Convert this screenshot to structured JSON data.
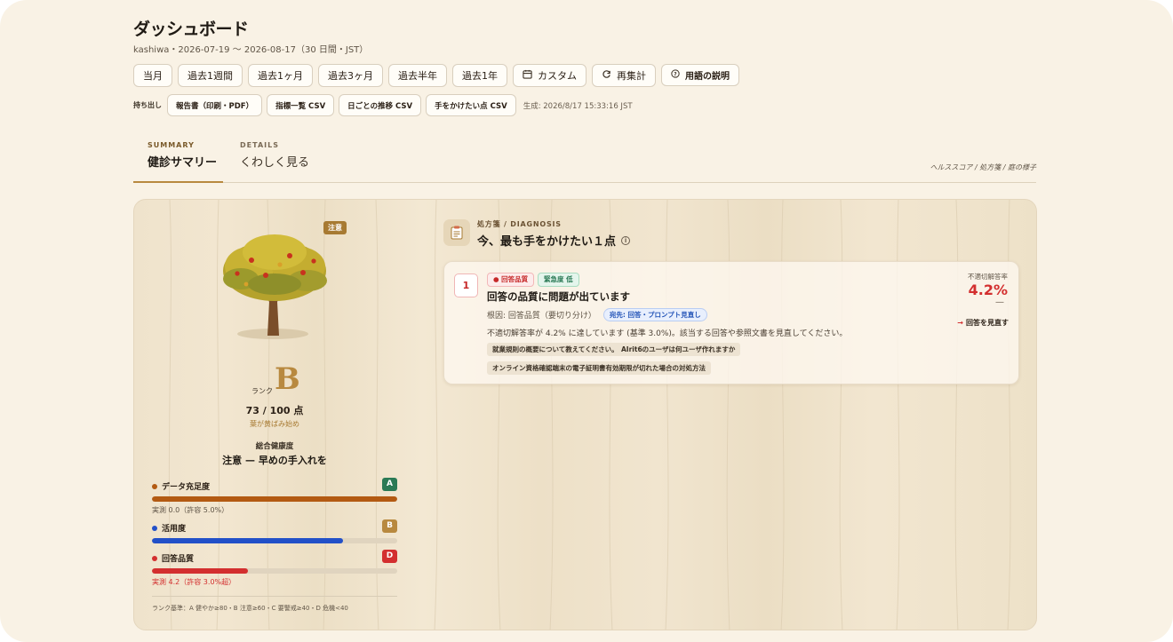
{
  "header": {
    "title": "ダッシュボード",
    "subtitle": "kashiwa・2026-07-19 〜 2026-08-17（30 日間・JST）"
  },
  "ranges": [
    {
      "label": "当月"
    },
    {
      "label": "過去1週間"
    },
    {
      "label": "過去1ヶ月"
    },
    {
      "label": "過去3ヶ月"
    },
    {
      "label": "過去半年"
    },
    {
      "label": "過去1年"
    }
  ],
  "toolbar": {
    "custom_label": "カスタム",
    "recalc_label": "再集計",
    "glossary_label": "用語の説明"
  },
  "export": {
    "label": "持ち出し",
    "report_label": "報告書（印刷・PDF）",
    "metrics_csv_label": "指標一覧 CSV",
    "daily_csv_label": "日ごとの推移 CSV",
    "issues_csv_label": "手をかけたい点 CSV",
    "generated_at": "生成: 2026/8/17 15:33:16 JST"
  },
  "tabs": {
    "summary": {
      "sup": "SUMMARY",
      "label": "健診サマリー"
    },
    "details": {
      "sup": "DETAILS",
      "label": "くわしく見る"
    },
    "right_note": "ヘルススコア / 処方箋 / 庭の様子"
  },
  "health": {
    "badge": "注意",
    "rank_label": "ランク",
    "rank": "B",
    "score": "73 / 100 点",
    "score_note": "葉が黄ばみ始め",
    "overall_label": "総合健康度",
    "overall_value": "注意 — 早めの手入れを",
    "metrics": [
      {
        "name": "データ充足度",
        "grade": "A",
        "fraction": 1.0,
        "note": "実測 0.0（許容 5.0%）",
        "color": "#b35a12",
        "grade_color": "#2a7a55",
        "note_color": "#5f5446"
      },
      {
        "name": "活用度",
        "grade": "B",
        "fraction": 0.78,
        "note": "",
        "color": "#2250c8",
        "grade_color": "#b8893f",
        "note_color": "#5f5446"
      },
      {
        "name": "回答品質",
        "grade": "D",
        "fraction": 0.39,
        "note": "実測 4.2（許容 3.0%超）",
        "color": "#d32f2f",
        "grade_color": "#d32f2f",
        "note_color": "#d32f2f"
      }
    ],
    "footnote": "ランク基準：A 健やか≥80・B 注意≥60・C 要警戒≥40・D 危機<40"
  },
  "diagnosis": {
    "sup": "処方箋 / DIAGNOSIS",
    "title": "今、最も手をかけたい１点",
    "card": {
      "number": "1",
      "tag_quality": "● 回答品質",
      "tag_urgency": "緊急度 低",
      "title": "回答の品質に問題が出ています",
      "cause": "根因: 回答品質（要切り分け）",
      "destination": "宛先: 回答・プロンプト見直し",
      "description": "不適切解答率が 4.2% に達しています (基準 3.0%)。該当する回答や参照文書を見直してください。",
      "chips": [
        "就業規則の概要について教えてください。",
        "AIrit6のユーザは何ユーザ作れますか",
        "オンライン資格確認端末の電子証明書有効期限が切れた場合の対処方法"
      ],
      "metric_label": "不適切解答率",
      "metric_value": "4.2%",
      "metric_sub": "—",
      "action_label": "回答を見直す"
    }
  },
  "colors": {
    "background": "#f9f2e5",
    "accent": "#b8893f",
    "danger": "#d32f2f"
  }
}
